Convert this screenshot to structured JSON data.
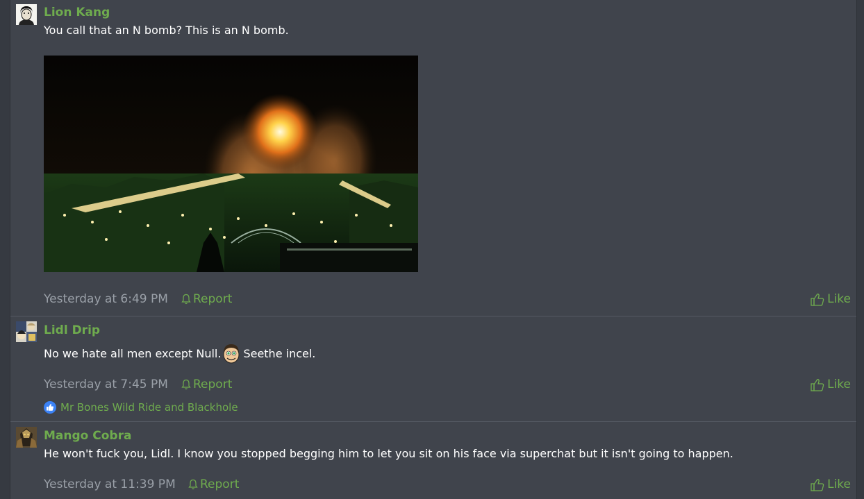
{
  "posts": [
    {
      "author": "Lion Kang",
      "body": "You call that an N bomb? This is an N bomb.",
      "timestamp": "Yesterday at 6:49 PM",
      "report_label": "Report",
      "like_label": "Like",
      "avatar_icon": "bearded-man-avatar-icon",
      "attachment_icon": "night-city-explosion-photo"
    },
    {
      "author": "Lidl Drip",
      "body_before": "No we hate all men except Null.",
      "body_after": "Seethe incel.",
      "smiley_icon": "null-face-smiley-icon",
      "timestamp": "Yesterday at 7:45 PM",
      "report_label": "Report",
      "like_label": "Like",
      "reactions_text": "Mr Bones Wild Ride and Blackhole",
      "reaction_icon": "thumbs-up-reaction-icon"
    },
    {
      "author": "Mango Cobra",
      "body": "He won't fuck you, Lidl. I know you stopped begging him to let you sit on his face via superchat but it isn't going to happen.",
      "timestamp": "Yesterday at 11:39 PM",
      "report_label": "Report",
      "like_label": "Like",
      "avatar_icon": "dark-figure-avatar-icon"
    }
  ],
  "colors": {
    "username": "#6fac4e",
    "link": "#6fac4e",
    "meta": "#9aa0a8",
    "post_bg": "#40444c",
    "page_bg": "#363a41"
  }
}
